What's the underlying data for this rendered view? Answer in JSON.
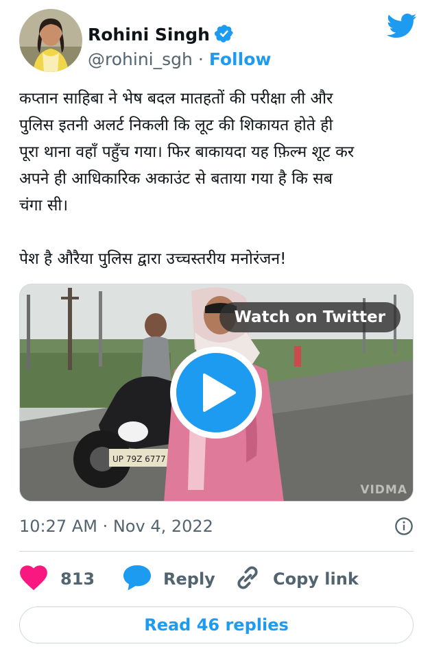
{
  "author": {
    "name": "Rohini Singh",
    "handle": "@rohini_sgh",
    "separator": "·",
    "follow_label": "Follow"
  },
  "tweet": {
    "text": "कप्तान साहिबा ने भेष बदल मातहतों की परीक्षा ली और\nपुलिस इतनी अलर्ट निकली कि लूट की शिकायत होते ही\nपूरा थाना वहाँ पहुँच गया। फिर बाकायदा यह फ़िल्म शूट कर\nअपने ही आधिकारिक अकाउंट से बताया गया है कि सब\nचंगा सी।\n\nपेश है औरैया पुलिस द्वारा उच्चस्तरीय मनोरंजन!"
  },
  "media": {
    "watch_label": "Watch on Twitter",
    "watermark": "VIDMA",
    "plate_text": "UP 79Z 6777"
  },
  "meta": {
    "time": "10:27 AM",
    "separator": "·",
    "date": "Nov 4, 2022"
  },
  "actions": {
    "like_count": "813",
    "reply_label": "Reply",
    "copy_label": "Copy link"
  },
  "read_replies_label": "Read 46 replies",
  "icons": {
    "verified": "verified-badge-icon",
    "logo": "twitter-bird-icon",
    "info": "info-icon",
    "like": "heart-icon",
    "reply": "speech-bubble-icon",
    "copy": "link-icon",
    "play": "play-icon"
  },
  "colors": {
    "accent": "#1d9bf0",
    "like": "#f91880",
    "text": "#0f1419",
    "muted": "#536471",
    "border": "#cfd9de"
  }
}
